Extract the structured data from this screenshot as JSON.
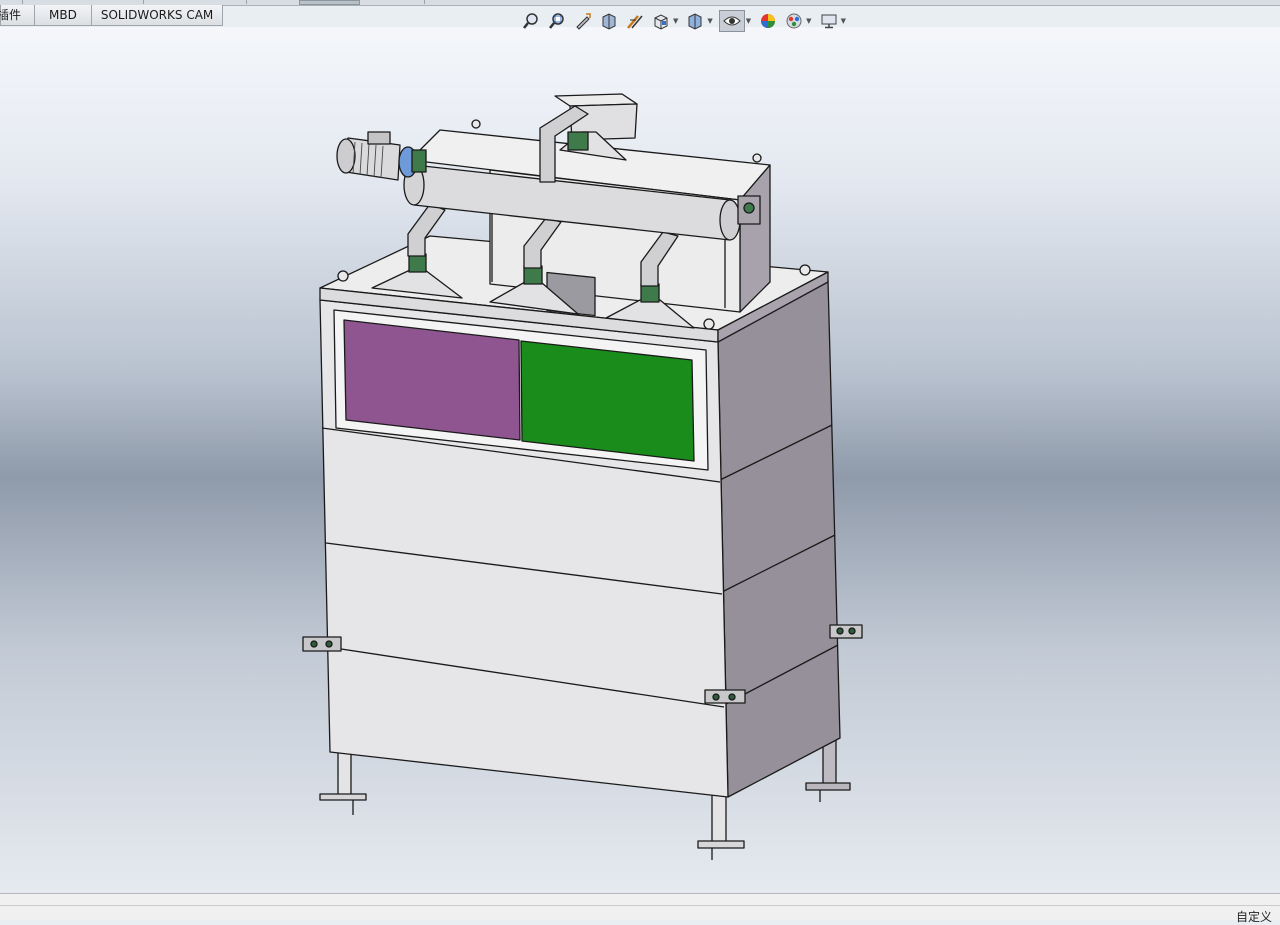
{
  "tabs": [
    {
      "label": "插件"
    },
    {
      "label": "MBD"
    },
    {
      "label": "SOLIDWORKS CAM"
    }
  ],
  "hud_toolbar": {
    "tools": [
      {
        "icon": "zoom-to-fit-icon"
      },
      {
        "icon": "zoom-to-area-icon"
      },
      {
        "icon": "previous-view-icon"
      },
      {
        "icon": "section-view-icon"
      },
      {
        "icon": "dynamic-annotation-icon"
      },
      {
        "icon": "view-orientation-icon",
        "dropdown": true
      },
      {
        "icon": "display-style-icon",
        "dropdown": true
      },
      {
        "icon": "hide-show-items-icon",
        "dropdown": true,
        "active": true
      },
      {
        "icon": "edit-appearance-icon"
      },
      {
        "icon": "apply-scene-icon",
        "dropdown": true
      },
      {
        "icon": "view-settings-icon",
        "dropdown": true
      }
    ]
  },
  "status_bar": {
    "text": "自定义"
  },
  "colors": {
    "panel_purple": "#8e5590",
    "panel_green": "#1a8c1c",
    "flange_green": "#3f7a4a",
    "body_light": "#e6e6e8",
    "body_side": "#949098"
  }
}
